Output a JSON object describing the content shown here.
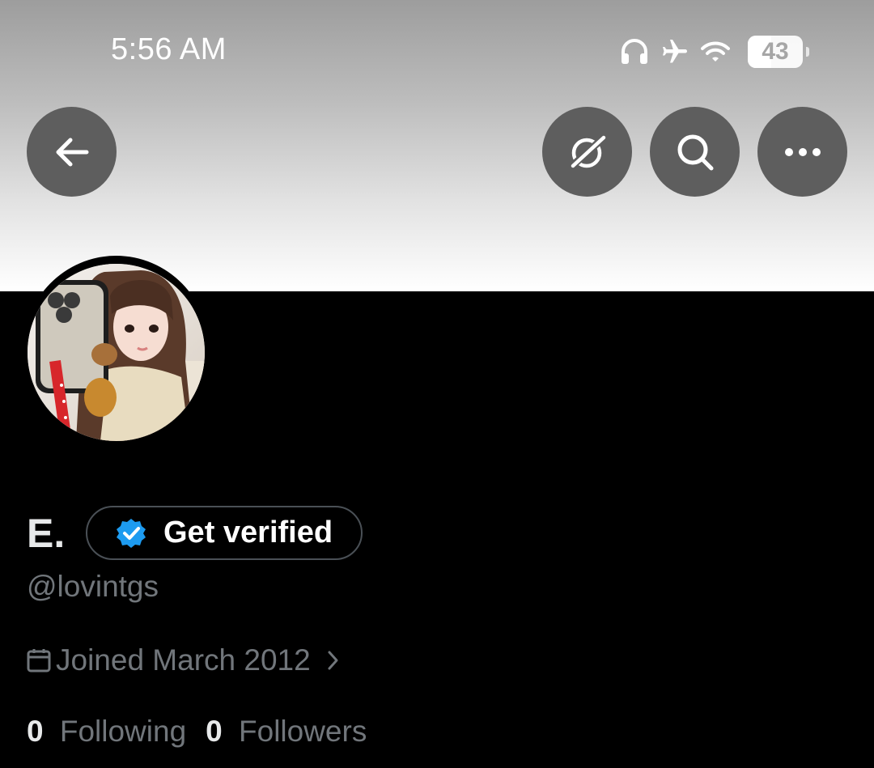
{
  "status_bar": {
    "time": "5:56 AM",
    "battery_level": "43",
    "battery_fraction": 0.43,
    "icons": [
      "headphones-icon",
      "airplane-icon",
      "wifi-icon",
      "battery-icon"
    ]
  },
  "header": {
    "back_icon": "arrow-left-icon",
    "grok_icon": "grok-icon",
    "search_icon": "search-icon",
    "more_icon": "more-horizontal-icon"
  },
  "profile": {
    "name": "E.",
    "verify_label": "Get verified",
    "handle": "@lovintgs",
    "joined": "Joined March 2012",
    "following_count": "0",
    "following_label": "Following",
    "followers_count": "0",
    "followers_label": "Followers"
  },
  "colors": {
    "background": "#000000",
    "verified_badge": "#1d9bf0",
    "secondary_text": "#71767b",
    "primary_text": "#e7e9ea"
  }
}
